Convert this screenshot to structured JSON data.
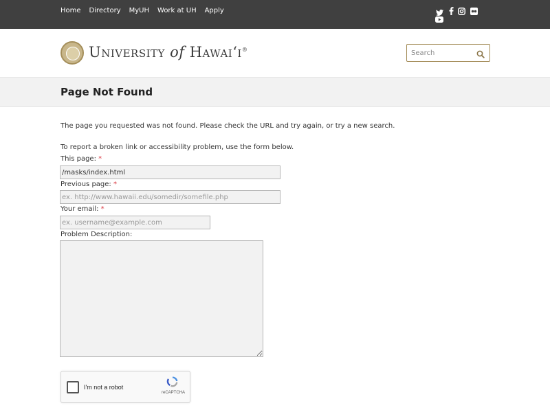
{
  "top_nav": {
    "items": [
      {
        "label": "Home"
      },
      {
        "label": "Directory"
      },
      {
        "label": "MyUH"
      },
      {
        "label": "Work at UH"
      },
      {
        "label": "Apply"
      }
    ],
    "social": [
      "twitter-icon",
      "facebook-icon",
      "instagram-icon",
      "flickr-icon",
      "youtube-icon"
    ]
  },
  "header": {
    "wordmark_part1": "University",
    "wordmark_of": "of",
    "wordmark_part2": "Hawaiʻi",
    "wordmark_reg": "®",
    "search": {
      "placeholder": "Search"
    }
  },
  "page": {
    "title": "Page Not Found"
  },
  "content": {
    "message": "The page you requested was not found. Please check the URL and try again, or try a new search.",
    "report_intro": "To report a broken link or accessibility problem, use the form below."
  },
  "form": {
    "this_page": {
      "label": "This page:",
      "required": "*",
      "value": "/masks/index.html"
    },
    "previous_page": {
      "label": "Previous page:",
      "required": "*",
      "placeholder": "ex. http://www.hawaii.edu/somedir/somefile.php"
    },
    "email": {
      "label": "Your email:",
      "required": "*",
      "placeholder": "ex. username@example.com"
    },
    "description": {
      "label": "Problem Description:"
    }
  },
  "captcha": {
    "label": "I'm not a robot",
    "brand": "reCAPTCHA"
  },
  "colors": {
    "topbar": "#404040",
    "accent": "#a28a55",
    "required": "#d9363e",
    "titlebar": "#f2f2f2"
  }
}
